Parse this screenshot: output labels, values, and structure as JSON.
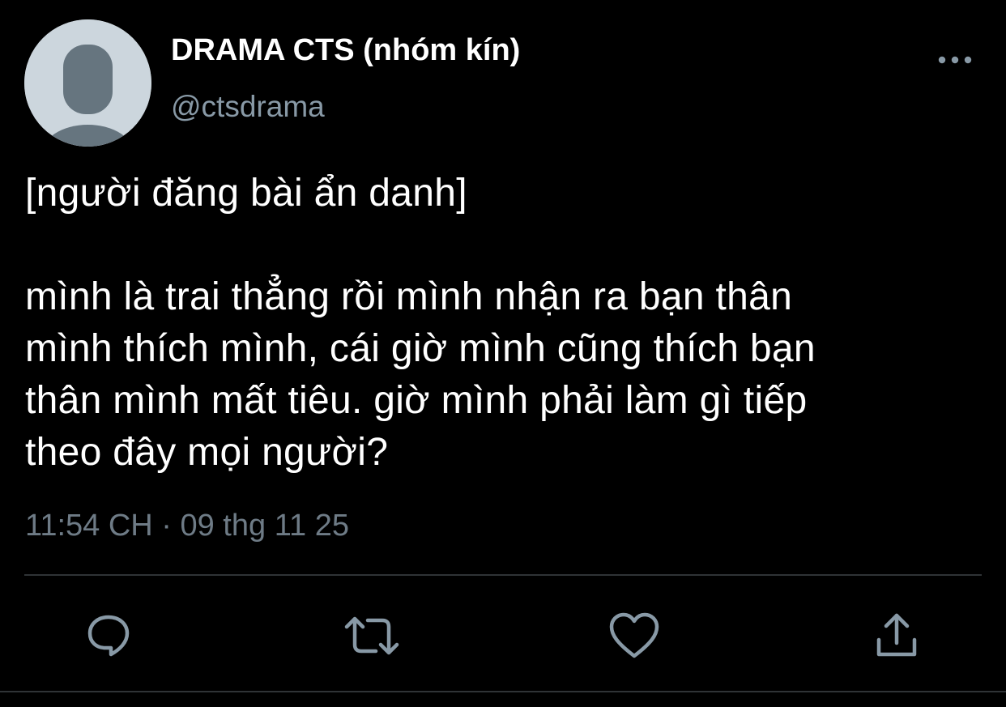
{
  "author": {
    "display_name": "DRAMA CTS (nhóm kín)",
    "handle": "@ctsdrama",
    "avatar_icon": "default-profile-icon"
  },
  "tweet": {
    "lines": [
      "[người đăng bài ẩn danh]",
      "",
      "mình là trai thẳng rồi mình nhận ra bạn thân",
      "mình thích mình, cái giờ mình cũng thích bạn",
      "thân mình mất tiêu. giờ mình phải làm gì tiếp",
      "theo đây mọi người?"
    ],
    "timestamp": "11:54 CH · 09 thg 11 25"
  },
  "actions": [
    {
      "icon": "reply-icon"
    },
    {
      "icon": "retweet-icon"
    },
    {
      "icon": "like-icon"
    },
    {
      "icon": "share-icon"
    }
  ],
  "menu_icon": "more-options-icon",
  "colors": {
    "background": "#000000",
    "text_primary": "#ffffff",
    "text_secondary": "#8899a6",
    "icon": "#8899a6",
    "divider": "#2f3336",
    "avatar_bg": "#ccd6dd",
    "avatar_fg": "#66757f"
  }
}
